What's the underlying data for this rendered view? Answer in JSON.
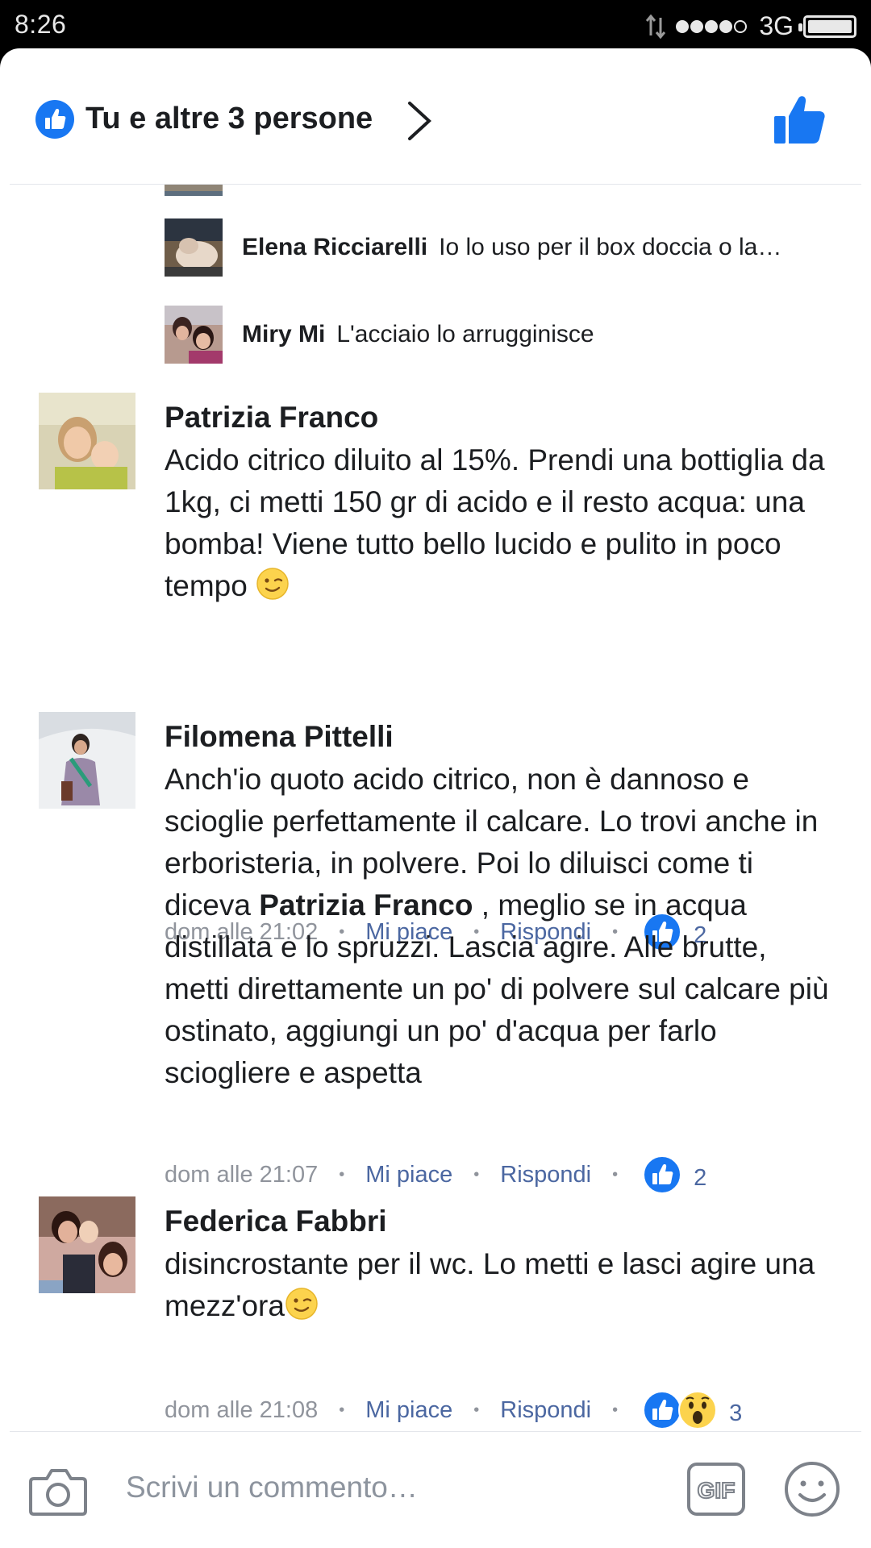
{
  "status_bar": {
    "time": "8:26",
    "network": "3G"
  },
  "header": {
    "reactors_text": "Tu e altre 3 persone"
  },
  "replies": [
    {
      "name": "Elena Ricciarelli",
      "text": "Io lo uso per il box doccia o la…"
    },
    {
      "name": "Miry Mi",
      "text": "L'acciaio lo arrugginisce"
    }
  ],
  "comments": [
    {
      "name": "Patrizia Franco",
      "text": "Acido citrico diluito al 15%. Prendi una bottiglia da 1kg, ci metti 150 gr di acido e il resto acqua: una bomba! Viene tutto bello lucido e pulito in poco tempo",
      "time": "dom alle 21:02",
      "like_label": "Mi piace",
      "reply_label": "Rispondi",
      "reaction_count": "2"
    },
    {
      "name": "Filomena Pittelli",
      "text_before": "Anch'io quoto acido citrico, non è dannoso e scioglie perfettamente il calcare. Lo trovi anche in erboristeria, in polvere. Poi lo diluisci come ti diceva ",
      "mention": "Patrizia Franco",
      "text_after": " , meglio se in acqua distillata e lo spruzzi. Lascia agire. Alle brutte, metti direttamente un po' di polvere sul calcare più ostinato, aggiungi un po' d'acqua per farlo sciogliere e aspetta",
      "time": "dom alle 21:07",
      "like_label": "Mi piace",
      "reply_label": "Rispondi",
      "reaction_count": "2"
    },
    {
      "name": "Federica Fabbri",
      "text": "disincrostante per il wc. Lo metti e lasci agire una mezz'ora",
      "time": "dom alle 21:08",
      "like_label": "Mi piace",
      "reply_label": "Rispondi",
      "reaction_count": "3"
    }
  ],
  "composer": {
    "placeholder": "Scrivi un commento…",
    "gif_label": "GIF"
  },
  "colors": {
    "facebook_blue": "#1877f2",
    "link_blue": "#4b67a1",
    "muted_gray": "#90949c",
    "wow_yellow": "#fcd34d"
  },
  "icons": [
    "like-badge-icon",
    "chevron-right-icon",
    "thumbs-up-icon",
    "wink-emoji-icon",
    "wow-reaction-icon",
    "camera-icon",
    "gif-icon",
    "smiley-icon"
  ]
}
